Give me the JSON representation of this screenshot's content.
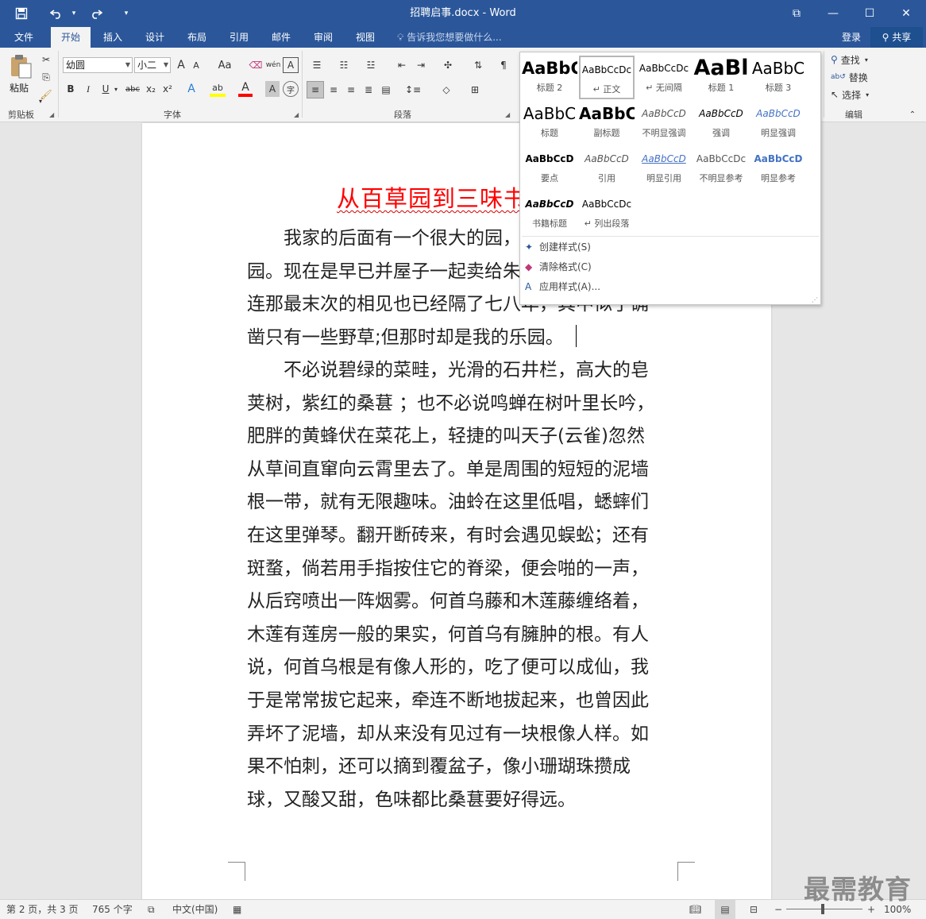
{
  "titlebar": {
    "title": "招聘启事.docx - Word",
    "save_icon": "floppy-icon",
    "undo_icon": "undo-icon",
    "redo_icon": "redo-icon",
    "restore_ribbon_glyph": "⧉",
    "minimize_glyph": "—",
    "maximize_glyph": "☐",
    "close_glyph": "✕"
  },
  "tabs": [
    "文件",
    "开始",
    "插入",
    "设计",
    "布局",
    "引用",
    "邮件",
    "审阅",
    "视图"
  ],
  "active_tab": "开始",
  "tellme": "告诉我您想要做什么...",
  "login": "登录",
  "share": "共享",
  "ribbon": {
    "clipboard": {
      "label": "剪贴板",
      "paste": "粘贴"
    },
    "font": {
      "label": "字体",
      "font_name": "幼圆",
      "font_size": "小二",
      "grow": "A",
      "shrink": "A",
      "change_case": "Aa",
      "phonetic": "wén",
      "border_char": "A",
      "bold": "B",
      "italic": "I",
      "underline": "U",
      "strike": "abc",
      "subscript": "x₂",
      "superscript": "x²",
      "effects": "A",
      "highlight": "ab",
      "font_color": "A",
      "shading": "A",
      "enclose": "字"
    },
    "paragraph": {
      "label": "段落"
    },
    "editing": {
      "label": "编辑",
      "find": "查找",
      "replace": "替换",
      "select": "选择"
    }
  },
  "gallery": {
    "styles": [
      {
        "sample": "AaBbC",
        "name": "标题 2"
      },
      {
        "sample": "AaBbCcDc",
        "name": "↵ 正文"
      },
      {
        "sample": "AaBbCcDc",
        "name": "↵ 无间隔"
      },
      {
        "sample": "AaBl",
        "name": "标题 1"
      },
      {
        "sample": "AaBbC",
        "name": "标题 3"
      },
      {
        "sample": "AaBbC",
        "name": "标题"
      },
      {
        "sample": "AaBbC",
        "name": "副标题"
      },
      {
        "sample": "AaBbCcD",
        "name": "不明显强调"
      },
      {
        "sample": "AaBbCcD",
        "name": "强调"
      },
      {
        "sample": "AaBbCcD",
        "name": "明显强调"
      },
      {
        "sample": "AaBbCcD",
        "name": "要点"
      },
      {
        "sample": "AaBbCcD",
        "name": "引用"
      },
      {
        "sample": "AaBbCcD",
        "name": "明显引用"
      },
      {
        "sample": "AaBbCcDc",
        "name": "不明显参考"
      },
      {
        "sample": "AaBbCcD",
        "name": "明显参考"
      },
      {
        "sample": "AaBbCcD",
        "name": "书籍标题"
      },
      {
        "sample": "AaBbCcDc",
        "name": "↵ 列出段落"
      }
    ],
    "actions": {
      "create": "创建样式(S)",
      "clear": "清除格式(C)",
      "apply": "应用样式(A)..."
    }
  },
  "document": {
    "heading": "从百草园到三味书屋",
    "lines": [
      "我家的后面有一个很大的园，",
      "园。现在是早已并屋子一起卖给朱",
      "连那最末次的相见也已经隔了七八年，其中似乎确",
      "凿只有一些野草;但那时却是我的乐园。",
      "不必说碧绿的菜畦，光滑的石井栏，高大的皂",
      "荚树，紫红的桑葚 ；也不必说鸣蝉在树叶里长吟，",
      "肥胖的黄蜂伏在菜花上，轻捷的叫天子(云雀)忽然",
      "从草间直窜向云霄里去了。单是周围的短短的泥墙",
      "根一带，就有无限趣味。油蛉在这里低唱，蟋蟀们",
      "在这里弹琴。翻开断砖来，有时会遇见蜈蚣；还有",
      "斑蝥，倘若用手指按住它的脊梁，便会啪的一声，",
      "从后窍喷出一阵烟雾。何首乌藤和木莲藤缠络着，",
      "木莲有莲房一般的果实，何首乌有臃肿的根。有人",
      "说，何首乌根是有像人形的，吃了便可以成仙，我",
      "于是常常拔它起来，牵连不断地拔起来，也曾因此",
      "弄坏了泥墙，却从来没有见过有一块根像人样。如",
      "果不怕刺，还可以摘到覆盆子，像小珊瑚珠攒成",
      "球，又酸又甜，色味都比桑葚要好得远。"
    ]
  },
  "status": {
    "page": "第 2 页，共 3 页",
    "words": "765 个字",
    "language": "中文(中国)",
    "zoom": "100%"
  },
  "watermark": "最需教育"
}
